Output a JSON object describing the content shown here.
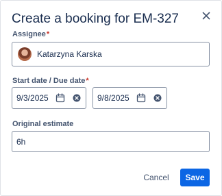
{
  "dialog": {
    "title": "Create a booking for EM-327",
    "close_icon": "close-icon"
  },
  "assignee": {
    "label": "Assignee",
    "required_marker": "*",
    "value": "Katarzyna Karska"
  },
  "dates": {
    "label": "Start date / Due date",
    "required_marker": "*",
    "start": {
      "value": "9/3/2025",
      "calendar_icon": "calendar-icon",
      "clear_icon": "clear-icon"
    },
    "due": {
      "value": "9/8/2025",
      "calendar_icon": "calendar-icon",
      "clear_icon": "clear-icon"
    }
  },
  "estimate": {
    "label": "Original estimate",
    "value": "6h"
  },
  "footer": {
    "cancel_label": "Cancel",
    "save_label": "Save"
  },
  "colors": {
    "primary": "#0c66e4",
    "required": "#c9372c",
    "text": "#172b4d",
    "subtle_text": "#44546f",
    "border": "#8590a2"
  }
}
